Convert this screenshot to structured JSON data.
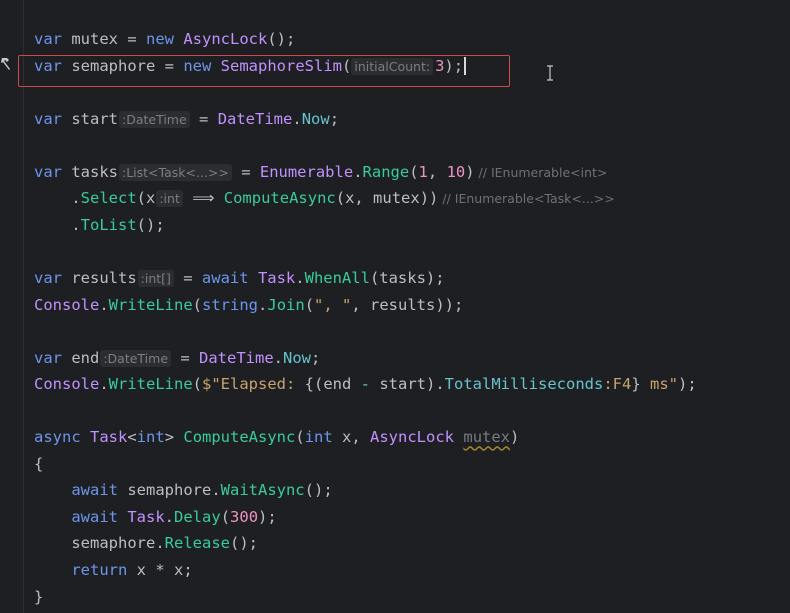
{
  "lines": [
    {
      "tokens": [
        {
          "t": "var",
          "c": "kw"
        },
        {
          "t": " mutex = ",
          "c": "pl"
        },
        {
          "t": "new",
          "c": "kw"
        },
        {
          "t": " ",
          "c": "pl"
        },
        {
          "t": "AsyncLock",
          "c": "ty"
        },
        {
          "t": "();",
          "c": "pl"
        }
      ]
    },
    {
      "tokens": [
        {
          "t": "var",
          "c": "kw"
        },
        {
          "t": " semaphore = ",
          "c": "pl"
        },
        {
          "t": "new",
          "c": "kw"
        },
        {
          "t": " ",
          "c": "pl"
        },
        {
          "t": "SemaphoreSlim",
          "c": "ty"
        },
        {
          "t": "(",
          "c": "pl"
        },
        {
          "t": "initialCount:",
          "c": "hint-pref"
        },
        {
          "t": "3",
          "c": "nu"
        },
        {
          "t": ");",
          "c": "pl"
        }
      ],
      "caret": true
    },
    {
      "tokens": []
    },
    {
      "tokens": [
        {
          "t": "var",
          "c": "kw"
        },
        {
          "t": " start",
          "c": "pl"
        },
        {
          "t": ":DateTime",
          "c": "hint"
        },
        {
          "t": " = ",
          "c": "pl"
        },
        {
          "t": "DateTime",
          "c": "ty"
        },
        {
          "t": ".",
          "c": "pl"
        },
        {
          "t": "Now",
          "c": "me"
        },
        {
          "t": ";",
          "c": "pl"
        }
      ]
    },
    {
      "tokens": []
    },
    {
      "tokens": [
        {
          "t": "var",
          "c": "kw"
        },
        {
          "t": " tasks",
          "c": "pl"
        },
        {
          "t": ":List<Task<...>>",
          "c": "hint"
        },
        {
          "t": " = ",
          "c": "pl"
        },
        {
          "t": "Enumerable",
          "c": "ty"
        },
        {
          "t": ".",
          "c": "pl"
        },
        {
          "t": "Range",
          "c": "fn"
        },
        {
          "t": "(",
          "c": "pl"
        },
        {
          "t": "1",
          "c": "nu"
        },
        {
          "t": ", ",
          "c": "pl"
        },
        {
          "t": "10",
          "c": "nu"
        },
        {
          "t": ")",
          "c": "pl"
        },
        {
          "t": " // IEnumerable<int>",
          "c": "comment-hint"
        }
      ]
    },
    {
      "tokens": [
        {
          "t": "    .",
          "c": "pl"
        },
        {
          "t": "Select",
          "c": "fn"
        },
        {
          "t": "(x",
          "c": "pl"
        },
        {
          "t": ":int",
          "c": "hint"
        },
        {
          "t": " ⟹ ",
          "c": "pl"
        },
        {
          "t": "ComputeAsync",
          "c": "fn"
        },
        {
          "t": "(x, mutex))",
          "c": "pl"
        },
        {
          "t": " // IEnumerable<Task<...>>",
          "c": "comment-hint"
        }
      ]
    },
    {
      "tokens": [
        {
          "t": "    .",
          "c": "pl"
        },
        {
          "t": "ToList",
          "c": "fn"
        },
        {
          "t": "();",
          "c": "pl"
        }
      ]
    },
    {
      "tokens": []
    },
    {
      "tokens": [
        {
          "t": "var",
          "c": "kw"
        },
        {
          "t": " results",
          "c": "pl"
        },
        {
          "t": ":int[]",
          "c": "hint"
        },
        {
          "t": " = ",
          "c": "pl"
        },
        {
          "t": "await",
          "c": "kw"
        },
        {
          "t": " ",
          "c": "pl"
        },
        {
          "t": "Task",
          "c": "ty"
        },
        {
          "t": ".",
          "c": "pl"
        },
        {
          "t": "WhenAll",
          "c": "fn"
        },
        {
          "t": "(tasks);",
          "c": "pl"
        }
      ]
    },
    {
      "tokens": [
        {
          "t": "Console",
          "c": "ty"
        },
        {
          "t": ".",
          "c": "pl"
        },
        {
          "t": "WriteLine",
          "c": "fn"
        },
        {
          "t": "(",
          "c": "pl"
        },
        {
          "t": "string",
          "c": "kw"
        },
        {
          "t": ".",
          "c": "pl"
        },
        {
          "t": "Join",
          "c": "fn"
        },
        {
          "t": "(",
          "c": "pl"
        },
        {
          "t": "\", \"",
          "c": "st"
        },
        {
          "t": ", results));",
          "c": "pl"
        }
      ]
    },
    {
      "tokens": []
    },
    {
      "tokens": [
        {
          "t": "var",
          "c": "kw"
        },
        {
          "t": " end",
          "c": "pl"
        },
        {
          "t": ":DateTime",
          "c": "hint"
        },
        {
          "t": " = ",
          "c": "pl"
        },
        {
          "t": "DateTime",
          "c": "ty"
        },
        {
          "t": ".",
          "c": "pl"
        },
        {
          "t": "Now",
          "c": "me"
        },
        {
          "t": ";",
          "c": "pl"
        }
      ]
    },
    {
      "tokens": [
        {
          "t": "Console",
          "c": "ty"
        },
        {
          "t": ".",
          "c": "pl"
        },
        {
          "t": "WriteLine",
          "c": "fn"
        },
        {
          "t": "(",
          "c": "pl"
        },
        {
          "t": "$\"Elapsed: ",
          "c": "st"
        },
        {
          "t": "{(end ",
          "c": "pl"
        },
        {
          "t": "-",
          "c": "me"
        },
        {
          "t": " start).",
          "c": "pl"
        },
        {
          "t": "TotalMilliseconds",
          "c": "me"
        },
        {
          "t": ":F4",
          "c": "st"
        },
        {
          "t": "}",
          "c": "pl"
        },
        {
          "t": " ms\"",
          "c": "st"
        },
        {
          "t": ");",
          "c": "pl"
        }
      ]
    },
    {
      "tokens": []
    },
    {
      "tokens": [
        {
          "t": "async",
          "c": "kw"
        },
        {
          "t": " ",
          "c": "pl"
        },
        {
          "t": "Task",
          "c": "ty"
        },
        {
          "t": "<",
          "c": "pl"
        },
        {
          "t": "int",
          "c": "kw"
        },
        {
          "t": "> ",
          "c": "pl"
        },
        {
          "t": "ComputeAsync",
          "c": "fn"
        },
        {
          "t": "(",
          "c": "pl"
        },
        {
          "t": "int",
          "c": "kw"
        },
        {
          "t": " x, ",
          "c": "pl"
        },
        {
          "t": "AsyncLock",
          "c": "ty"
        },
        {
          "t": " ",
          "c": "pl"
        },
        {
          "t": "mutex",
          "c": "un"
        },
        {
          "t": ")",
          "c": "pl"
        }
      ]
    },
    {
      "tokens": [
        {
          "t": "{",
          "c": "pl"
        }
      ]
    },
    {
      "tokens": [
        {
          "t": "    ",
          "c": "pl"
        },
        {
          "t": "await",
          "c": "kw"
        },
        {
          "t": " semaphore.",
          "c": "pl"
        },
        {
          "t": "WaitAsync",
          "c": "fn"
        },
        {
          "t": "();",
          "c": "pl"
        }
      ]
    },
    {
      "tokens": [
        {
          "t": "    ",
          "c": "pl"
        },
        {
          "t": "await",
          "c": "kw"
        },
        {
          "t": " ",
          "c": "pl"
        },
        {
          "t": "Task",
          "c": "ty"
        },
        {
          "t": ".",
          "c": "pl"
        },
        {
          "t": "Delay",
          "c": "fn"
        },
        {
          "t": "(",
          "c": "pl"
        },
        {
          "t": "300",
          "c": "nu"
        },
        {
          "t": ");",
          "c": "pl"
        }
      ]
    },
    {
      "tokens": [
        {
          "t": "    semaphore.",
          "c": "pl"
        },
        {
          "t": "Release",
          "c": "fn"
        },
        {
          "t": "();",
          "c": "pl"
        }
      ]
    },
    {
      "tokens": [
        {
          "t": "    ",
          "c": "pl"
        },
        {
          "t": "return",
          "c": "kw"
        },
        {
          "t": " x * x;",
          "c": "pl"
        }
      ]
    },
    {
      "tokens": [
        {
          "t": "}",
          "c": "pl"
        }
      ]
    }
  ],
  "icons": {
    "gutter": "hammer-icon",
    "cursor": "text-cursor-icon"
  }
}
